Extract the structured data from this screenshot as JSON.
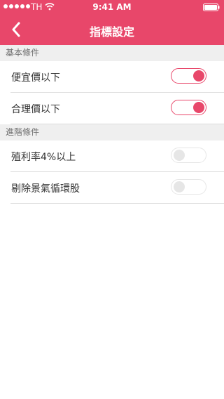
{
  "status_bar": {
    "carrier": "TH",
    "time": "9:41 AM",
    "signal_icon": "signal-dots-icon",
    "wifi_icon": "wifi-icon",
    "battery_icon": "battery-icon"
  },
  "nav": {
    "title": "指標設定",
    "back_icon": "chevron-left-icon"
  },
  "colors": {
    "accent": "#e8476a",
    "section_bg": "#efefef",
    "divider": "#dddddd",
    "toggle_off": "#e6e6e6"
  },
  "sections": [
    {
      "title": "基本條件",
      "items": [
        {
          "label": "便宜價以下",
          "enabled": true
        },
        {
          "label": "合理價以下",
          "enabled": true
        }
      ]
    },
    {
      "title": "進階條件",
      "items": [
        {
          "label": "殖利率4%以上",
          "enabled": false
        },
        {
          "label": "剔除景氣循環股",
          "enabled": false
        }
      ]
    }
  ]
}
